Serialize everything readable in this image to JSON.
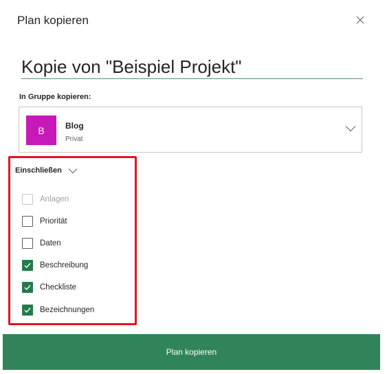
{
  "dialog": {
    "title": "Plan kopieren",
    "close_icon": "close-icon"
  },
  "plan_name": {
    "value": "Kopie von \"Beispiel Projekt\""
  },
  "group": {
    "label": "In Gruppe kopieren:",
    "avatar_letter": "B",
    "avatar_color": "#c719b7",
    "name": "Blog",
    "privacy": "Privat",
    "chevron_icon": "chevron-down-icon"
  },
  "include": {
    "label": "Einschließen",
    "chevron_icon": "chevron-down-icon",
    "options": [
      {
        "label": "Anlagen",
        "checked": false,
        "disabled": true
      },
      {
        "label": "Priorität",
        "checked": false,
        "disabled": false
      },
      {
        "label": "Daten",
        "checked": false,
        "disabled": false
      },
      {
        "label": "Beschreibung",
        "checked": true,
        "disabled": false
      },
      {
        "label": "Checkliste",
        "checked": true,
        "disabled": false
      },
      {
        "label": "Bezeichnungen",
        "checked": true,
        "disabled": false
      }
    ]
  },
  "submit": {
    "label": "Plan kopieren"
  },
  "colors": {
    "accent": "#31845a",
    "checkbox_checked": "#237b4b",
    "highlight": "#e81123"
  }
}
